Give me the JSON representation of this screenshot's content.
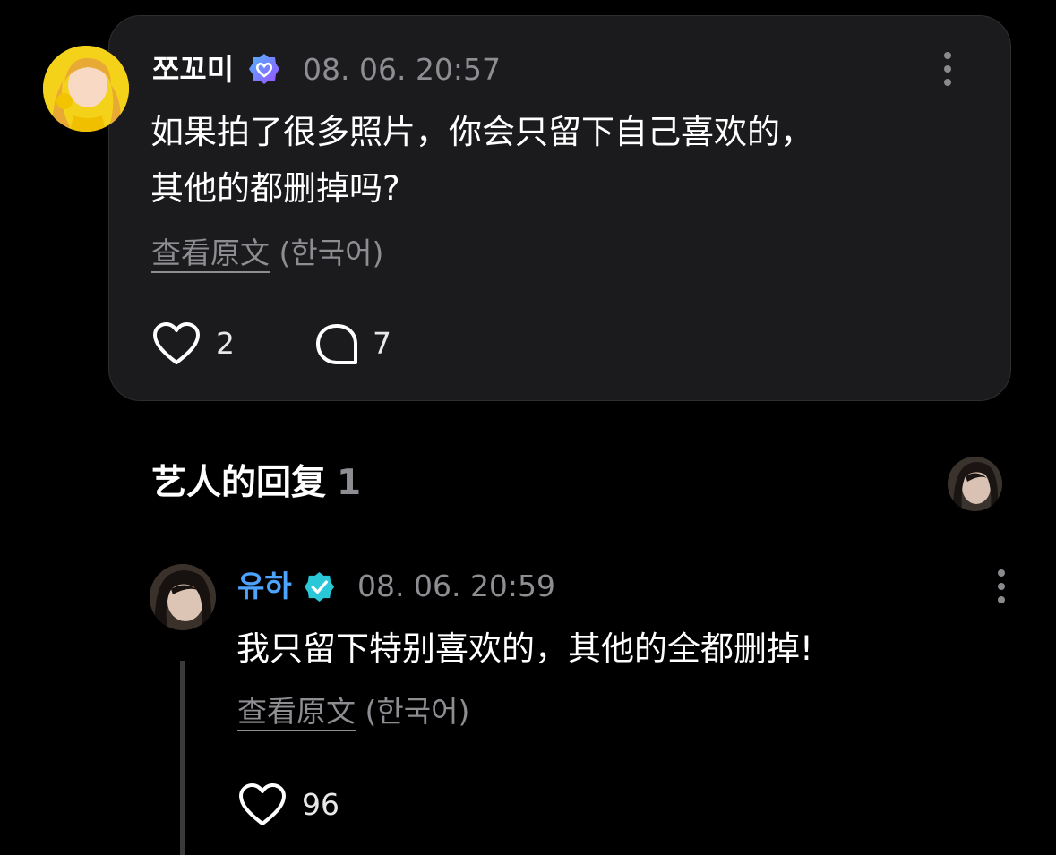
{
  "post": {
    "author": "쪼꼬미",
    "timestamp": "08. 06. 20:57",
    "text_line1": "如果拍了很多照片，你会只留下自己喜欢的，",
    "text_line2": "其他的都删掉吗?",
    "translate_link": "查看原文",
    "translate_lang": "(한국어)",
    "likes": "2",
    "comments": "7",
    "colors": {
      "avatar_bg": "#f5d21a",
      "badge": "#7a5cff"
    }
  },
  "artist_reply_section": {
    "title": "艺人的回复",
    "count": "1"
  },
  "reply": {
    "author": "유하",
    "timestamp": "08. 06. 20:59",
    "text": "我只留下特别喜欢的，其他的全都删掉!",
    "translate_link": "查看原文",
    "translate_lang": "(한국어)",
    "likes": "96",
    "colors": {
      "name": "#4ea3ff",
      "badge": "#29c7d8"
    }
  },
  "icons": [
    "heart-icon",
    "comment-icon",
    "more-icon",
    "verified-badge-icon"
  ]
}
